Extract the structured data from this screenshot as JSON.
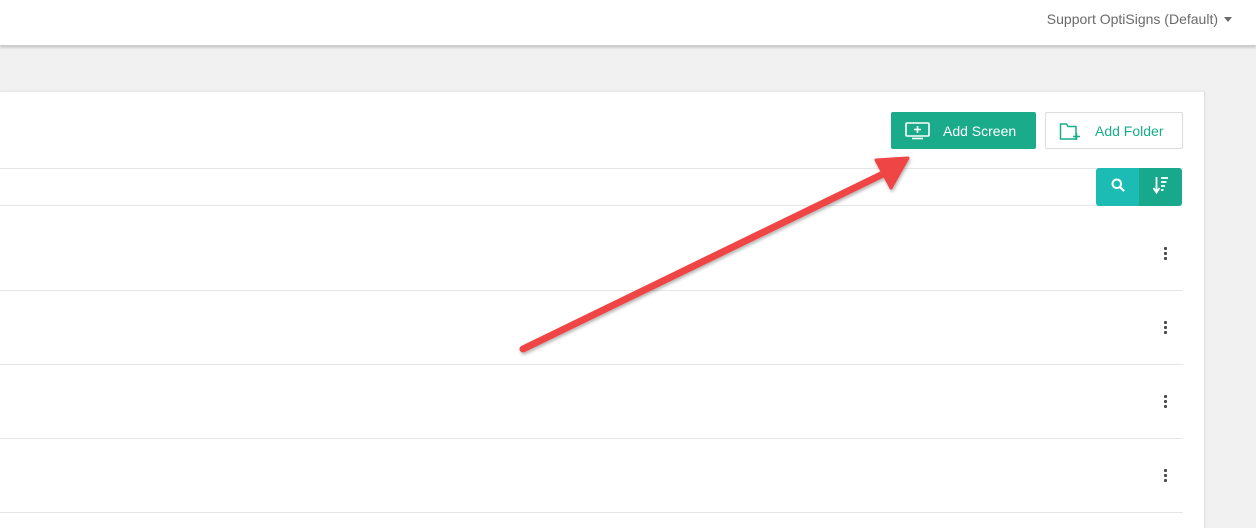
{
  "header": {
    "account_label": "Support OptiSigns (Default)",
    "caret_icon": "caret-down-icon"
  },
  "toolbar": {
    "add_screen_label": "Add Screen",
    "add_screen_icon": "monitor-plus-icon",
    "add_folder_label": "Add Folder",
    "add_folder_icon": "folder-plus-icon"
  },
  "search": {
    "value": "",
    "placeholder": "",
    "search_icon": "search-icon",
    "sort_icon": "sort-descending-icon"
  },
  "list": {
    "row_count_visible": 4,
    "row_menu_icon": "kebab-menu-icon"
  },
  "annotation": {
    "arrow_color": "#ef4444",
    "points_to": "Add Screen"
  },
  "colors": {
    "primary": "#1aab8a",
    "search_button": "#1cbcb4",
    "background": "#f1f1f1"
  }
}
